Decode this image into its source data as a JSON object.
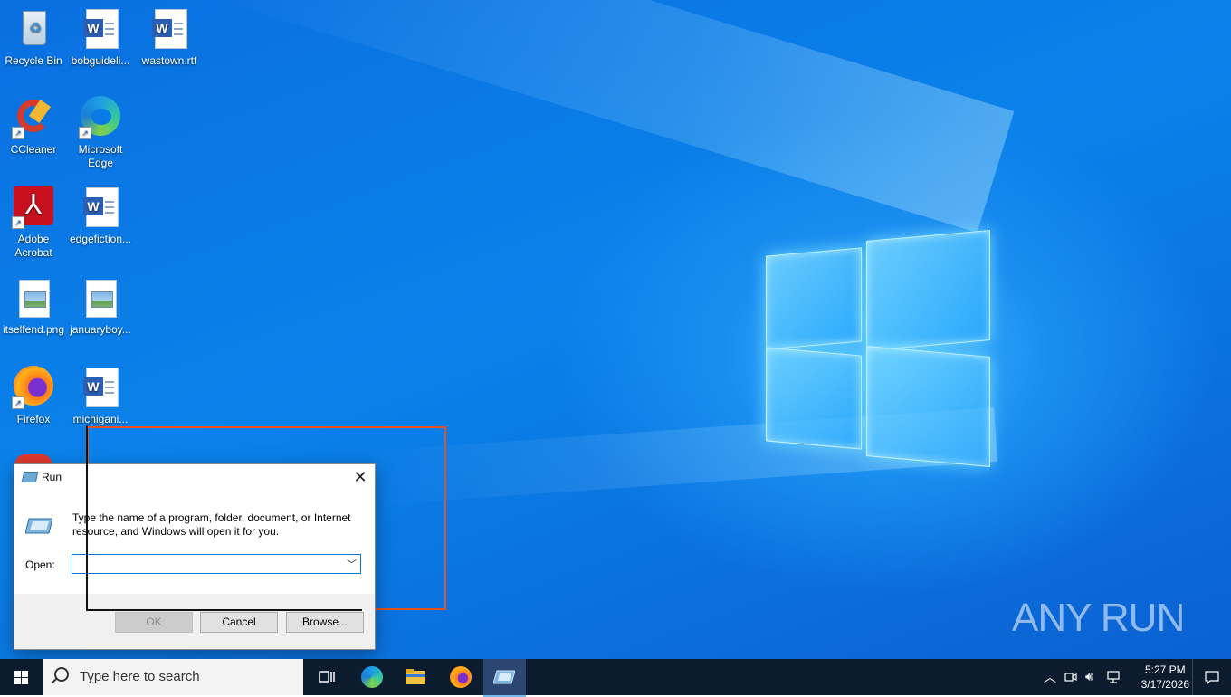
{
  "desktop": {
    "icons": [
      {
        "label": "Recycle Bin"
      },
      {
        "label": "bobguideli..."
      },
      {
        "label": "wastown.rtf"
      },
      {
        "label": "CCleaner"
      },
      {
        "label": "Microsoft Edge"
      },
      {
        "label": "Adobe Acrobat"
      },
      {
        "label": "edgefiction..."
      },
      {
        "label": "itselfend.png"
      },
      {
        "label": "januaryboy..."
      },
      {
        "label": "Firefox"
      },
      {
        "label": "michigani..."
      }
    ]
  },
  "run_dialog": {
    "title": "Run",
    "description": "Type the name of a program, folder, document, or Internet resource, and Windows will open it for you.",
    "open_label": "Open:",
    "open_value": "",
    "ok_label": "OK",
    "cancel_label": "Cancel",
    "browse_label": "Browse..."
  },
  "watermark": "ANY RUN",
  "taskbar": {
    "search_placeholder": "Type here to search",
    "time": "5:27 PM",
    "date": "3/17/2026"
  }
}
